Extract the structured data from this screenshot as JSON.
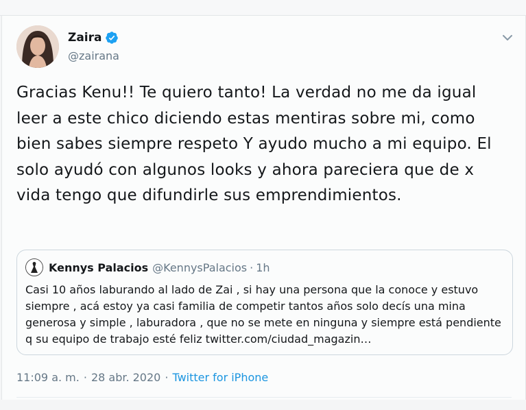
{
  "tweet": {
    "author_name": "Zaira",
    "author_handle": "@zairana",
    "text": "Gracias Kenu!! Te quiero tanto! La verdad no me da igual leer a este chico diciendo estas mentiras sobre mi, como bien sabes siempre respeto Y ayudo mucho a mi equipo. El solo ayudó con algunos looks y ahora pareciera que de x vida tengo que difundirle sus emprendimientos.",
    "time": "11:09 a. m.",
    "separator": "·",
    "date": "28 abr. 2020",
    "source": "Twitter for iPhone"
  },
  "quote": {
    "author_name": "Kennys Palacios",
    "author_handle": "@KennysPalacios",
    "separator": "·",
    "time": "1h",
    "text": "Casi 10 años laburando al lado de Zai , si hay una persona que la conoce y estuvo siempre , acá estoy ya casi familia de competir tantos  años solo decís una mina generosa y simple , laburadora , que no se mete en ninguna y siempre está pendiente q su equipo de trabajo esté feliz twitter.com/ciudad_magazin…"
  },
  "colors": {
    "text": "#14171a",
    "secondary": "#657786",
    "link": "#1b95e0",
    "verified": "#1da1f2"
  },
  "icons": {
    "verified": "verified-badge-icon",
    "menu": "chevron-down-icon"
  }
}
